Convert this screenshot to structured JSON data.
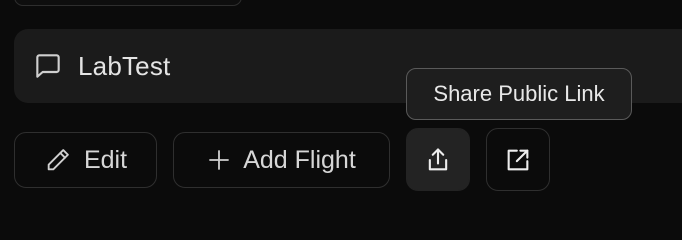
{
  "item": {
    "name": "LabTest",
    "icon": "message-square-icon"
  },
  "tooltip": {
    "text": "Share Public Link"
  },
  "actions": {
    "edit_label": "Edit",
    "edit_icon": "pencil-icon",
    "add_flight_label": "Add Flight",
    "add_flight_icon": "plus-icon",
    "share_icon": "share-icon",
    "open_icon": "external-link-icon"
  },
  "colors": {
    "background": "#0b0b0b",
    "field": "#1b1b1b",
    "text": "#e4e4e4",
    "border": "#2f2f2f"
  }
}
